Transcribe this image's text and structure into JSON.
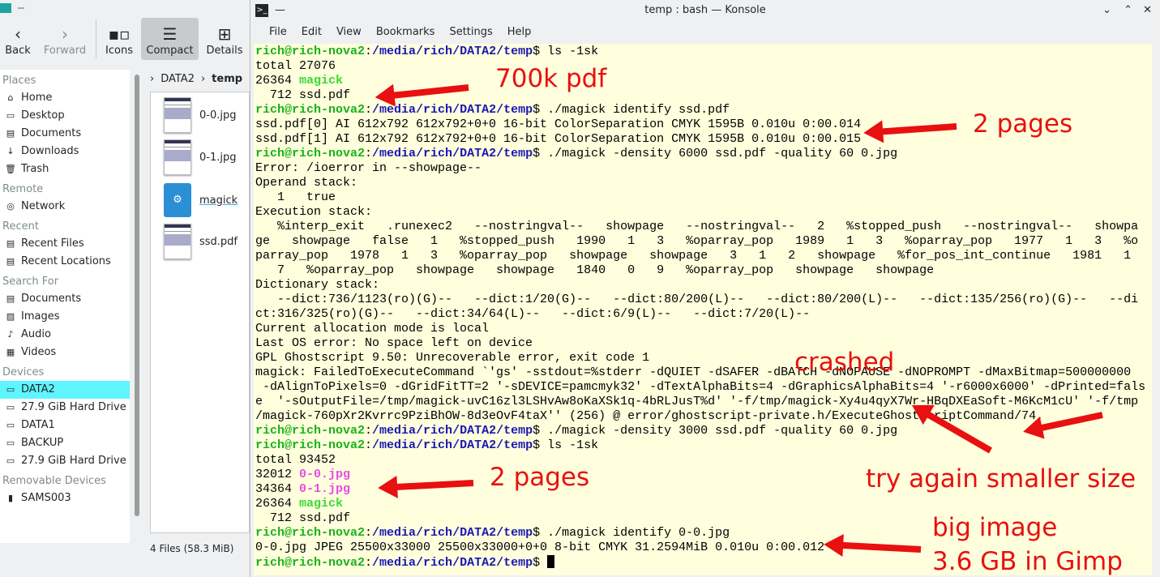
{
  "dolphin": {
    "toolbar": [
      {
        "label": "Back",
        "icon": "chevron-left-icon"
      },
      {
        "label": "Forward",
        "icon": "chevron-right-icon"
      },
      {
        "label": "Icons",
        "icon": "icons-view-icon"
      },
      {
        "label": "Compact",
        "icon": "compact-view-icon"
      },
      {
        "label": "Details",
        "icon": "details-view-icon"
      }
    ],
    "sections": [
      {
        "title": "Places",
        "items": [
          "Home",
          "Desktop",
          "Documents",
          "Downloads",
          "Trash"
        ]
      },
      {
        "title": "Remote",
        "items": [
          "Network"
        ]
      },
      {
        "title": "Recent",
        "items": [
          "Recent Files",
          "Recent Locations"
        ]
      },
      {
        "title": "Search For",
        "items": [
          "Documents",
          "Images",
          "Audio",
          "Videos"
        ]
      },
      {
        "title": "Devices",
        "items": [
          "DATA2",
          "27.9 GiB Hard Drive",
          "DATA1",
          "BACKUP",
          "27.9 GiB Hard Drive"
        ]
      },
      {
        "title": "Removable Devices",
        "items": [
          "SAMS003"
        ]
      }
    ],
    "breadcrumb": [
      "DATA2",
      "temp"
    ],
    "files": [
      "0-0.jpg",
      "0-1.jpg",
      "magick",
      "ssd.pdf"
    ],
    "status": "4 Files (58.3 MiB)"
  },
  "konsole": {
    "title": "temp : bash — Konsole",
    "menu": [
      "File",
      "Edit",
      "View",
      "Bookmarks",
      "Settings",
      "Help"
    ],
    "lines": [
      [
        [
          "g",
          "rich@rich-nova2"
        ],
        [
          "k",
          ":"
        ],
        [
          "b",
          "/media/rich/DATA2/temp"
        ],
        [
          "k",
          "$ ls -1sk"
        ]
      ],
      [
        [
          "k",
          "total 27076"
        ]
      ],
      [
        [
          "k",
          "26364 "
        ],
        [
          "gr",
          "magick"
        ]
      ],
      [
        [
          "k",
          "  712 ssd.pdf"
        ]
      ],
      [
        [
          "g",
          "rich@rich-nova2"
        ],
        [
          "k",
          ":"
        ],
        [
          "b",
          "/media/rich/DATA2/temp"
        ],
        [
          "k",
          "$ ./magick identify ssd.pdf"
        ]
      ],
      [
        [
          "k",
          "ssd.pdf[0] AI 612x792 612x792+0+0 16-bit ColorSeparation CMYK 1595B 0.010u 0:00.014"
        ]
      ],
      [
        [
          "k",
          "ssd.pdf[1] AI 612x792 612x792+0+0 16-bit ColorSeparation CMYK 1595B 0.010u 0:00.015"
        ]
      ],
      [
        [
          "g",
          "rich@rich-nova2"
        ],
        [
          "k",
          ":"
        ],
        [
          "b",
          "/media/rich/DATA2/temp"
        ],
        [
          "k",
          "$ ./magick -density 6000 ssd.pdf -quality 60 0.jpg"
        ]
      ],
      [
        [
          "k",
          "Error: /ioerror in --showpage--"
        ]
      ],
      [
        [
          "k",
          "Operand stack:"
        ]
      ],
      [
        [
          "k",
          "   1   true"
        ]
      ],
      [
        [
          "k",
          "Execution stack:"
        ]
      ],
      [
        [
          "k",
          "   %interp_exit   .runexec2   --nostringval--   showpage   --nostringval--   2   %stopped_push   --nostringval--   showpa"
        ]
      ],
      [
        [
          "k",
          "ge   showpage   false   1   %stopped_push   1990   1   3   %oparray_pop   1989   1   3   %oparray_pop   1977   1   3   %o"
        ]
      ],
      [
        [
          "k",
          "parray_pop   1978   1   3   %oparray_pop   showpage   showpage   3   1   2   showpage   %for_pos_int_continue   1981   1"
        ]
      ],
      [
        [
          "k",
          "   7   %oparray_pop   showpage   showpage   1840   0   9   %oparray_pop   showpage   showpage"
        ]
      ],
      [
        [
          "k",
          "Dictionary stack:"
        ]
      ],
      [
        [
          "k",
          "   --dict:736/1123(ro)(G)--   --dict:1/20(G)--   --dict:80/200(L)--   --dict:80/200(L)--   --dict:135/256(ro)(G)--   --di"
        ]
      ],
      [
        [
          "k",
          "ct:316/325(ro)(G)--   --dict:34/64(L)--   --dict:6/9(L)--   --dict:7/20(L)--"
        ]
      ],
      [
        [
          "k",
          "Current allocation mode is local"
        ]
      ],
      [
        [
          "k",
          "Last OS error: No space left on device"
        ]
      ],
      [
        [
          "k",
          "GPL Ghostscript 9.50: Unrecoverable error, exit code 1"
        ]
      ],
      [
        [
          "k",
          "magick: FailedToExecuteCommand `'gs' -sstdout=%stderr -dQUIET -dSAFER -dBATCH -dNOPAUSE -dNOPROMPT -dMaxBitmap=500000000"
        ]
      ],
      [
        [
          "k",
          " -dAlignToPixels=0 -dGridFitTT=2 '-sDEVICE=pamcmyk32' -dTextAlphaBits=4 -dGraphicsAlphaBits=4 '-r6000x6000' -dPrinted=fals"
        ]
      ],
      [
        [
          "k",
          "e  '-sOutputFile=/tmp/magick-uvC16zl3LSHvAw8oKaXSk1q-4bRLJusT%d' '-f/tmp/magick-Xy4u4qyX7Wr-HBqDXEaSoft-M6KcM1cU' '-f/tmp"
        ]
      ],
      [
        [
          "k",
          "/magick-760pXr2Kvrrc9PziBhOW-8d3eOvF4taX'' (256) @ error/ghostscript-private.h/ExecuteGhostscriptCommand/74."
        ]
      ],
      [
        [
          "g",
          "rich@rich-nova2"
        ],
        [
          "k",
          ":"
        ],
        [
          "b",
          "/media/rich/DATA2/temp"
        ],
        [
          "k",
          "$ ./magick -density 3000 ssd.pdf -quality 60 0.jpg"
        ]
      ],
      [
        [
          "g",
          "rich@rich-nova2"
        ],
        [
          "k",
          ":"
        ],
        [
          "b",
          "/media/rich/DATA2/temp"
        ],
        [
          "k",
          "$ ls -1sk"
        ]
      ],
      [
        [
          "k",
          "total 93452"
        ]
      ],
      [
        [
          "k",
          "32012 "
        ],
        [
          "m",
          "0-0.jpg"
        ]
      ],
      [
        [
          "k",
          "34364 "
        ],
        [
          "m",
          "0-1.jpg"
        ]
      ],
      [
        [
          "k",
          "26364 "
        ],
        [
          "gr",
          "magick"
        ]
      ],
      [
        [
          "k",
          "  712 ssd.pdf"
        ]
      ],
      [
        [
          "g",
          "rich@rich-nova2"
        ],
        [
          "k",
          ":"
        ],
        [
          "b",
          "/media/rich/DATA2/temp"
        ],
        [
          "k",
          "$ ./magick identify 0-0.jpg"
        ]
      ],
      [
        [
          "k",
          "0-0.jpg JPEG 25500x33000 25500x33000+0+0 8-bit CMYK 31.2594MiB 0.010u 0:00.012"
        ]
      ],
      [
        [
          "g",
          "rich@rich-nova2"
        ],
        [
          "k",
          ":"
        ],
        [
          "b",
          "/media/rich/DATA2/temp"
        ],
        [
          "k",
          "$ "
        ]
      ]
    ]
  },
  "annotations": {
    "a1": "700k pdf",
    "a2": "2 pages",
    "a3": "crashed",
    "a4": "2 pages",
    "a5": "try again smaller size",
    "a6": "big image",
    "a7": "3.6 GB in Gimp"
  },
  "colors": {
    "annotation": "#e81010",
    "terminal_bg": "#ffffdd",
    "prompt_user": "#18b218",
    "prompt_path": "#1818b2"
  }
}
